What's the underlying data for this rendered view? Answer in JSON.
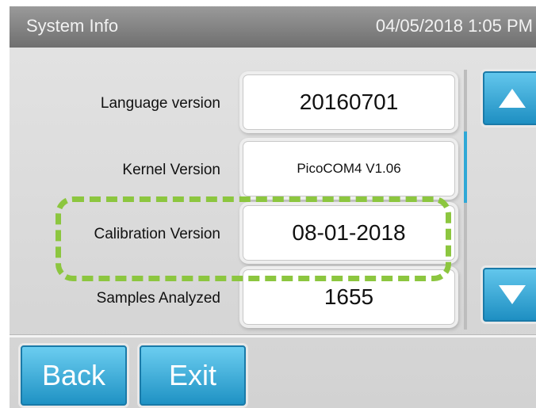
{
  "header": {
    "title": "System Info",
    "datetime": "04/05/2018 1:05 PM"
  },
  "rows": [
    {
      "label": "Language version",
      "value": "20160701"
    },
    {
      "label": "Kernel Version",
      "value": "PicoCOM4 V1.06"
    },
    {
      "label": "Calibration Version",
      "value": "08-01-2018"
    },
    {
      "label": "Samples Analyzed",
      "value": "1655"
    }
  ],
  "scroll": {
    "up_icon": "triangle-up-icon",
    "down_icon": "triangle-down-icon"
  },
  "footer": {
    "back_label": "Back",
    "exit_label": "Exit"
  },
  "colors": {
    "accent": "#2fa8d6",
    "highlight": "#8cc63f",
    "titlebar": "#7f7f7f"
  }
}
